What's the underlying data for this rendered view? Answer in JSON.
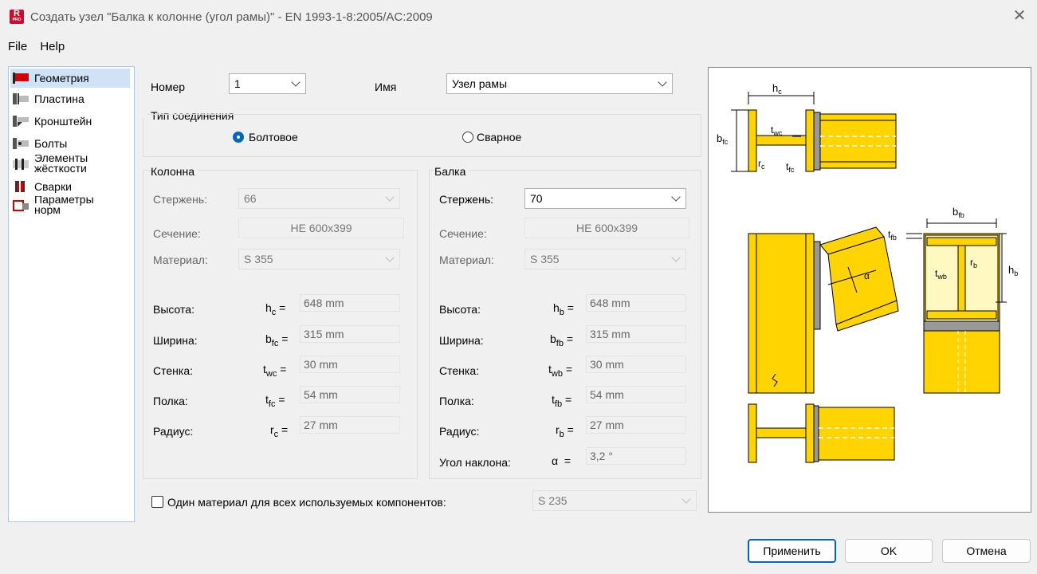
{
  "window": {
    "title": "Создать узел \"Балка к колонне (угол рамы)\" - EN 1993-1-8:2005/AC:2009",
    "app_icon": "R",
    "app_icon_sub": "PRO"
  },
  "menu": {
    "file": "File",
    "help": "Help"
  },
  "sidebar": {
    "items": [
      {
        "label": "Геометрия",
        "icon": "red-flag-icon"
      },
      {
        "label": "Пластина",
        "icon": "plate-icon"
      },
      {
        "label": "Кронштейн",
        "icon": "bracket-icon"
      },
      {
        "label": "Болты",
        "icon": "bolts-icon"
      },
      {
        "label": "Элементы жёсткости",
        "icon": "stiffener-icon"
      },
      {
        "label": "Сварки",
        "icon": "weld-icon"
      },
      {
        "label": "Параметры норм",
        "icon": "code-params-icon"
      }
    ]
  },
  "header": {
    "number_label": "Номер",
    "number_value": "1",
    "name_label": "Имя",
    "name_value": "Узел рамы"
  },
  "connection": {
    "title": "Тип соединения",
    "bolted": "Болтовое",
    "welded": "Сварное"
  },
  "column": {
    "title": "Колонна",
    "member_label": "Стержень:",
    "member_value": "66",
    "section_label": "Сечение:",
    "section_value": "HE 600x399",
    "material_label": "Материал:",
    "material_value": "S 355",
    "height_label": "Высота:",
    "height_sym": "h",
    "height_sub": "c",
    "height_value": "648 mm",
    "width_label": "Ширина:",
    "width_sym": "b",
    "width_sub": "fc",
    "width_value": "315 mm",
    "web_label": "Стенка:",
    "web_sym": "t",
    "web_sub": "wc",
    "web_value": "30 mm",
    "flange_label": "Полка:",
    "flange_sym": "t",
    "flange_sub": "fc",
    "flange_value": "54 mm",
    "radius_label": "Радиус:",
    "radius_sym": "r",
    "radius_sub": "c",
    "radius_value": "27 mm"
  },
  "beam": {
    "title": "Балка",
    "member_label": "Стержень:",
    "member_value": "70",
    "section_label": "Сечение:",
    "section_value": "HE 600x399",
    "material_label": "Материал:",
    "material_value": "S 355",
    "height_label": "Высота:",
    "height_sym": "h",
    "height_sub": "b",
    "height_value": "648 mm",
    "width_label": "Ширина:",
    "width_sym": "b",
    "width_sub": "fb",
    "width_value": "315 mm",
    "web_label": "Стенка:",
    "web_sym": "t",
    "web_sub": "wb",
    "web_value": "30 mm",
    "flange_label": "Полка:",
    "flange_sym": "t",
    "flange_sub": "fb",
    "flange_value": "54 mm",
    "radius_label": "Радиус:",
    "radius_sym": "r",
    "radius_sub": "b",
    "radius_value": "27 mm",
    "angle_label": "Угол наклона:",
    "angle_sym": "α",
    "angle_value": "3,2 °"
  },
  "single_material": {
    "label": "Один материал для всех используемых компонентов:",
    "value": "S 235"
  },
  "diagram": {
    "h_c": "h",
    "h_c_sub": "c",
    "b_fc": "b",
    "b_fc_sub": "fc",
    "t_wc": "t",
    "t_wc_sub": "wc",
    "t_fc": "t",
    "t_fc_sub": "fc",
    "r_c": "r",
    "r_c_sub": "c",
    "b_fb": "b",
    "b_fb_sub": "fb",
    "t_fb": "t",
    "t_fb_sub": "fb",
    "r_b": "r",
    "r_b_sub": "b",
    "t_wb": "t",
    "t_wb_sub": "wb",
    "h_b": "h",
    "h_b_sub": "b",
    "alpha": "α"
  },
  "buttons": {
    "apply": "Применить",
    "ok": "OK",
    "cancel": "Отмена"
  },
  "colors": {
    "steel": "#ffd400",
    "accent": "#0067c0",
    "flag": "#d40000"
  }
}
